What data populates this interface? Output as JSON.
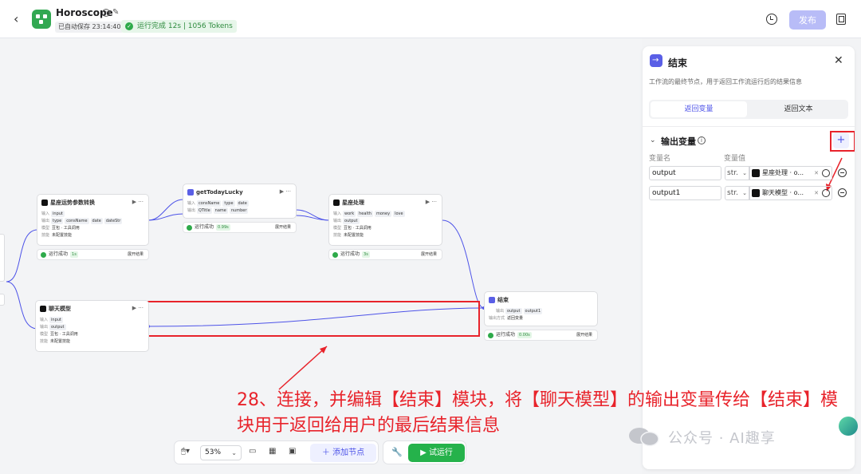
{
  "header": {
    "app_title": "Horoscope",
    "autosave": "已自动保存 23:14:40",
    "run_status": "运行完成 12s | 1056 Tokens",
    "publish_label": "发布"
  },
  "canvas": {
    "nodes": {
      "n1": {
        "title": "星座运势参数转换",
        "rows": [
          {
            "label": "输入",
            "tags": [
              "input"
            ]
          },
          {
            "label": "输出",
            "tags": [
              "type",
              "consName",
              "date",
              "dateStr"
            ]
          },
          {
            "label": "模型",
            "value": "豆包 · 工具调用"
          },
          {
            "label": "技能",
            "value": "未配置技能"
          }
        ],
        "status": "运行成功",
        "time": "1s",
        "expand": "展开结果"
      },
      "n2": {
        "title": "getTodayLucky",
        "rows": [
          {
            "label": "输入",
            "tags": [
              "consName",
              "type",
              "date"
            ]
          },
          {
            "label": "输出",
            "tags": [
              "QTitle",
              "name",
              "number"
            ]
          }
        ],
        "status": "运行成功",
        "time": "0.99s",
        "expand": "展开结果"
      },
      "n3": {
        "title": "星座处理",
        "rows": [
          {
            "label": "输入",
            "tags": [
              "work",
              "health",
              "money",
              "love"
            ]
          },
          {
            "label": "输出",
            "tags": [
              "output"
            ]
          },
          {
            "label": "模型",
            "value": "豆包 · 工具调用"
          },
          {
            "label": "技能",
            "value": "未配置技能"
          }
        ],
        "status": "运行成功",
        "time": "3s",
        "expand": "展开结果"
      },
      "n4": {
        "title": "聊天模型",
        "rows": [
          {
            "label": "输入",
            "tags": [
              "input"
            ]
          },
          {
            "label": "输出",
            "tags": [
              "output"
            ]
          },
          {
            "label": "模型",
            "value": "豆包 · 工具调用"
          },
          {
            "label": "技能",
            "value": "未配置技能"
          }
        ]
      },
      "n5": {
        "title": "结束",
        "rows": [
          {
            "label": "输出",
            "tags": [
              "output",
              "output1"
            ]
          },
          {
            "label": "输出方式",
            "value": "返回变量"
          }
        ],
        "status": "运行成功",
        "time": "0.00s",
        "expand": "展开结果"
      }
    }
  },
  "toolbar": {
    "zoom": "53%",
    "add_node": "添加节点",
    "trial_run": "试运行"
  },
  "panel": {
    "title": "结束",
    "description": "工作流的最终节点，用于返回工作流运行后的结果信息",
    "tabs": [
      "返回变量",
      "返回文本"
    ],
    "active_tab": 0,
    "section_title": "输出变量",
    "col_name": "变量名",
    "col_value": "变量值",
    "variables": [
      {
        "name": "output",
        "type": "str.",
        "ref": "星座处理 · o..."
      },
      {
        "name": "output1",
        "type": "str.",
        "ref": "聊天模型 · o..."
      }
    ]
  },
  "annotation": {
    "text": "28、连接，并编辑【结束】模块，将【聊天模型】的输出变量传给【结束】模块用于返回给用户的最后结果信息",
    "color": "#e8232b"
  },
  "watermark": "公众号 · AI趣享",
  "colors": {
    "accent": "#4d53e8",
    "run_green": "#25b24b",
    "success": "#2eaa4a",
    "annotation_red": "#e8232b"
  }
}
